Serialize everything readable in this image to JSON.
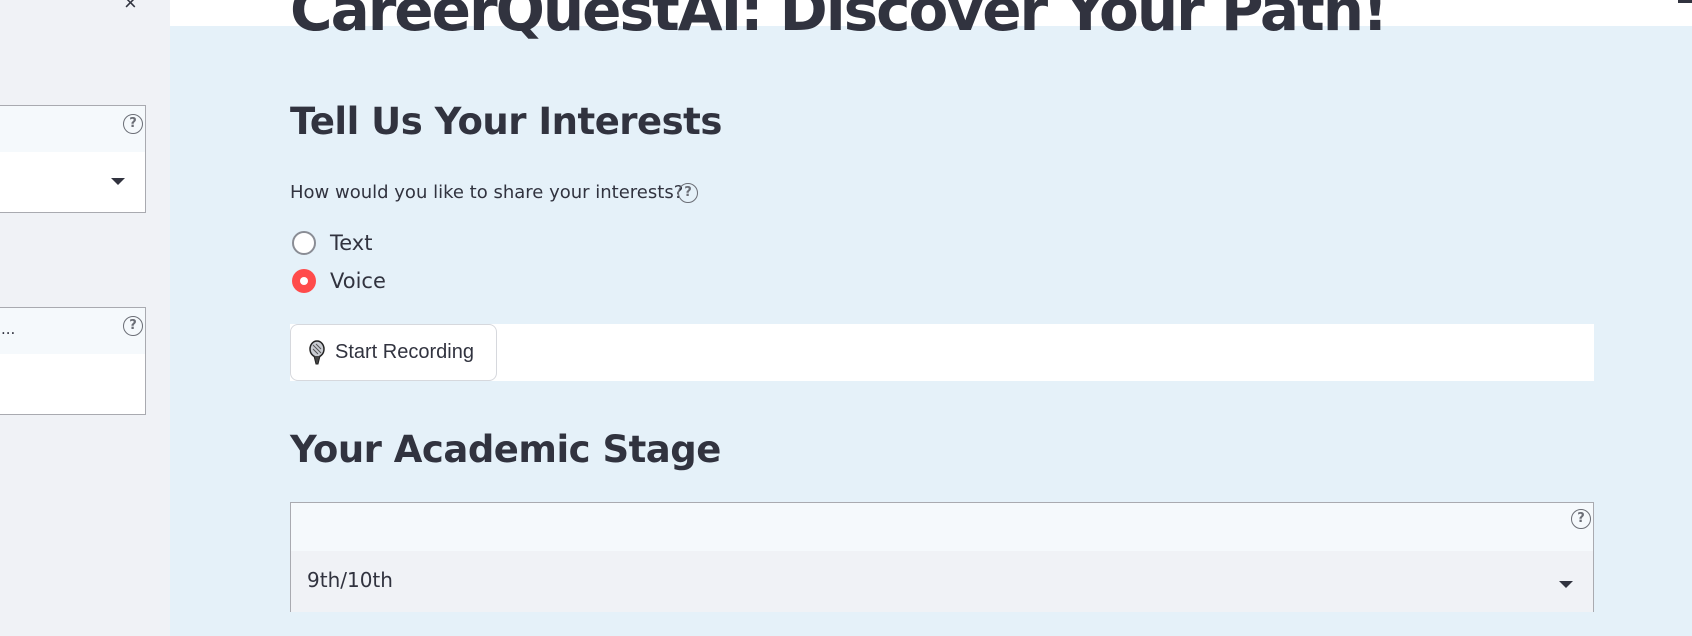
{
  "sidebar": {
    "close_icon": "×",
    "help_icon": "?",
    "truncated_text": "..."
  },
  "main": {
    "title": "CareerQuestAI: Discover Your Path!",
    "interests": {
      "heading": "Tell Us Your Interests",
      "question": "How would you like to share your interests?",
      "help_icon": "?",
      "options": [
        {
          "label": "Text",
          "selected": false
        },
        {
          "label": "Voice",
          "selected": true
        }
      ],
      "record_button_label": "Start Recording",
      "record_icon": "microphone-icon"
    },
    "academic": {
      "heading": "Your Academic Stage",
      "help_icon": "?",
      "selected_value": "9th/10th"
    }
  },
  "colors": {
    "accent": "#ff4b4b",
    "main_background": "#e5f1f9",
    "sidebar_background": "#f0f2f6"
  }
}
